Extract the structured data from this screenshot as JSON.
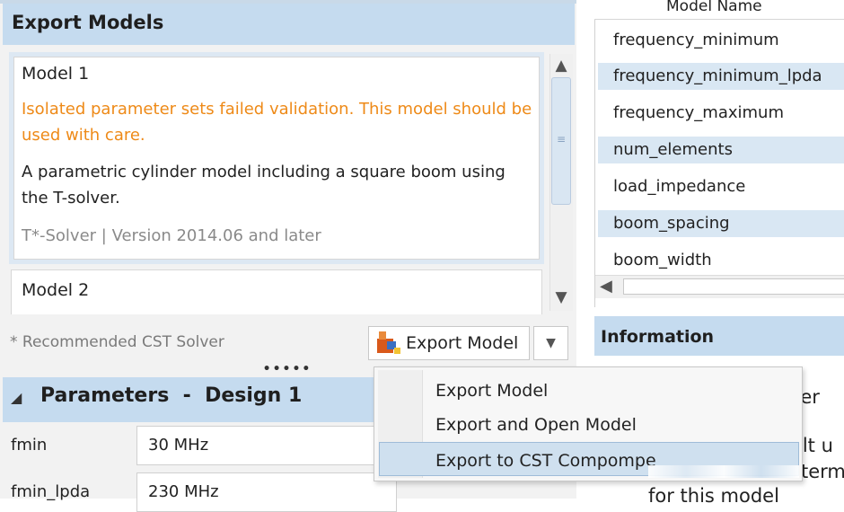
{
  "export_panel": {
    "title": "Export Models",
    "models": [
      {
        "name": "Model 1",
        "warning": "Isolated parameter sets failed validation. This model should be used with care.",
        "description": "A parametric cylinder model including a square boom using the T-solver.",
        "footer": "T*-Solver | Version 2014.06 and later"
      },
      {
        "name": "Model 2"
      }
    ],
    "recommended_note": "* Recommended CST Solver",
    "export_button_label": "Export Model",
    "splitter_glyph": "•••••"
  },
  "parameters": {
    "title": "Parameters  -  Design 1",
    "fields": [
      {
        "label": "fmin",
        "value": "30 MHz"
      },
      {
        "label": "fmin_lpda",
        "value": "230 MHz"
      }
    ]
  },
  "model_names": {
    "column_header": "Model Name",
    "rows": [
      "frequency_minimum",
      "frequency_minimum_lpda",
      "frequency_maximum",
      "num_elements",
      "load_impedance",
      "boom_spacing",
      "boom_width"
    ]
  },
  "information": {
    "title": "Information",
    "visible_fragments": [
      "der",
      "ilt u",
      "term",
      "for this model"
    ]
  },
  "export_menu": {
    "items": [
      "Export Model",
      "Export and Open Model",
      "Export to CST Compompe"
    ]
  },
  "colors": {
    "header_bg": "#c5dbef",
    "warning": "#ee8a18",
    "row_alt": "#d9e7f3",
    "menu_highlight": "#cfe0ef"
  },
  "icons": {
    "scroll_up": "▲",
    "scroll_down": "▼",
    "scroll_left": "◀",
    "caret_down": "▼",
    "collapse": "◢"
  }
}
